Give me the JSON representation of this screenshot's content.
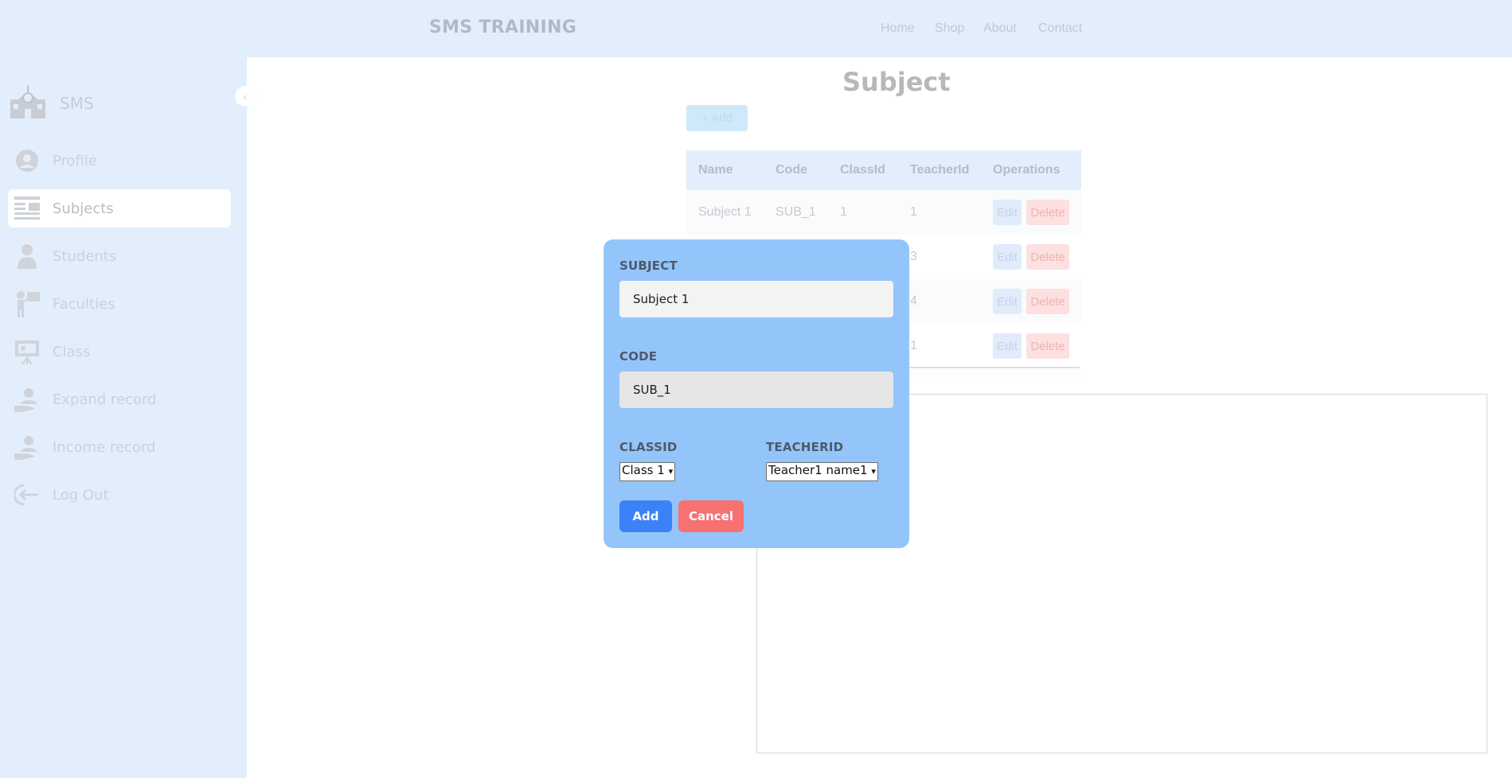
{
  "header": {
    "brand": "SMS TRAINING",
    "nav": [
      "Home",
      "Shop",
      "About",
      "Contact"
    ]
  },
  "sidebar": {
    "title": "SMS",
    "items": [
      {
        "label": "Profile",
        "icon": "user-circle-icon"
      },
      {
        "label": "Subjects",
        "icon": "list-icon"
      },
      {
        "label": "Students",
        "icon": "student-icon"
      },
      {
        "label": "Faculties",
        "icon": "teacher-icon"
      },
      {
        "label": "Class",
        "icon": "classroom-icon"
      },
      {
        "label": "Expand record",
        "icon": "hand-user-icon"
      },
      {
        "label": "Income record",
        "icon": "hand-user-icon"
      },
      {
        "label": "Log Out",
        "icon": "logout-icon"
      }
    ],
    "active": "Subjects"
  },
  "main": {
    "title": "Subject",
    "add_label": "+ Add",
    "table": {
      "headers": [
        "Name",
        "Code",
        "ClassId",
        "TeacherId",
        "Operations"
      ],
      "rows": [
        {
          "name": "Subject 1",
          "code": "SUB_1",
          "classid": "1",
          "teacherid": "1"
        },
        {
          "name": "",
          "code": "",
          "classid": "",
          "teacherid": "3"
        },
        {
          "name": "",
          "code": "",
          "classid": "",
          "teacherid": "4"
        },
        {
          "name": "",
          "code": "",
          "classid": "",
          "teacherid": "1"
        }
      ],
      "edit_label": "Edit",
      "delete_label": "Delete"
    }
  },
  "modal": {
    "subject_label": "SUBJECT",
    "subject_value": "Subject 1",
    "code_label": "CODE",
    "code_value": "SUB_1",
    "classid_label": "CLASSID",
    "classid_value": "Class 1",
    "teacherid_label": "TEACHERID",
    "teacherid_value": "Teacher1 name1",
    "add_button": "Add",
    "cancel_button": "Cancel"
  },
  "colors": {
    "topbar_bg": "#e3eefc",
    "modal_bg": "#93c5fb",
    "add_button": "#3b82f6",
    "cancel_button": "#f87171"
  }
}
